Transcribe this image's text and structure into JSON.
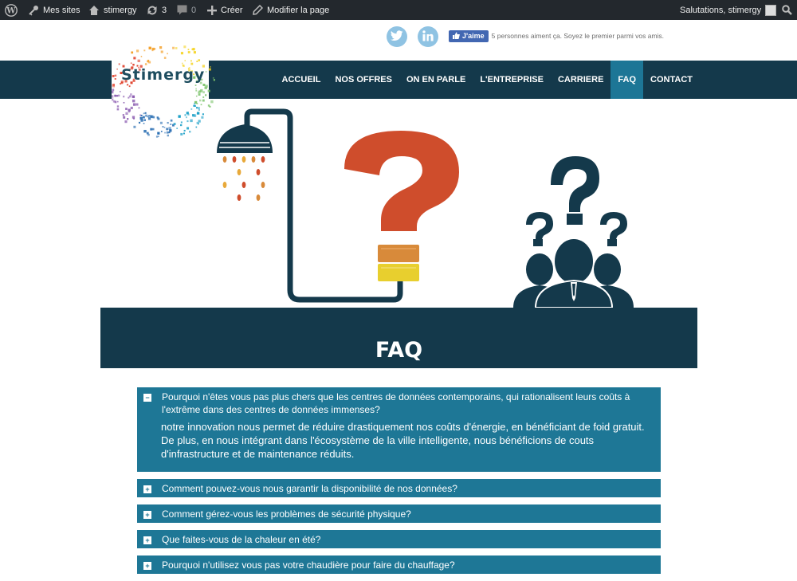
{
  "adminbar": {
    "my_sites": "Mes sites",
    "site_name": "stimergy",
    "updates_count": "3",
    "comments_count": "0",
    "create": "Créer",
    "edit_page": "Modifier la page",
    "greeting": "Salutations, stimergy"
  },
  "header": {
    "logo_text": "Stimergy",
    "facebook": {
      "button_label": "J'aime",
      "text": "5 personnes aiment ça. Soyez le premier parmi vos amis."
    }
  },
  "nav": {
    "items": [
      {
        "label": "ACCUEIL"
      },
      {
        "label": "NOS OFFRES"
      },
      {
        "label": "ON EN PARLE"
      },
      {
        "label": "L'ENTREPRISE"
      },
      {
        "label": "CARRIERE"
      },
      {
        "label": "FAQ"
      },
      {
        "label": "CONTACT"
      }
    ],
    "active": "FAQ"
  },
  "page": {
    "title": "FAQ"
  },
  "faq": [
    {
      "question": "Pourquoi n'êtes vous pas plus chers que les centres de données contemporains, qui rationalisent leurs coûts à l'extrême dans des centres de données immenses?",
      "answer": "notre innovation nous permet de réduire drastiquement nos coûts d'énergie, en bénéficiant de foid gratuit. De plus, en nous intégrant dans l'écosystème de la ville intelligente, nous bénéficions de couts d'infrastructure et de maintenance réduits.",
      "open": true
    },
    {
      "question": "Comment pouvez-vous nous garantir la disponibilité de nos données?",
      "open": false
    },
    {
      "question": "Comment gérez-vous les problèmes de sécurité physique?",
      "open": false
    },
    {
      "question": "Que faites-vous de la chaleur en été?",
      "open": false
    },
    {
      "question": "Pourquoi n'utilisez vous pas votre chaudière pour faire du chauffage?",
      "open": false
    }
  ],
  "colors": {
    "navy": "#14394b",
    "accent_blue": "#1e7796",
    "question_red": "#cf4d2c",
    "orange": "#d88a3a",
    "yellow": "#e8cf2e"
  },
  "icons": [
    "wordpress-icon",
    "key-icon",
    "home-icon",
    "refresh-icon",
    "comment-icon",
    "plus-icon",
    "pencil-icon",
    "search-icon",
    "twitter-icon",
    "linkedin-icon",
    "facebook-thumb-icon"
  ]
}
